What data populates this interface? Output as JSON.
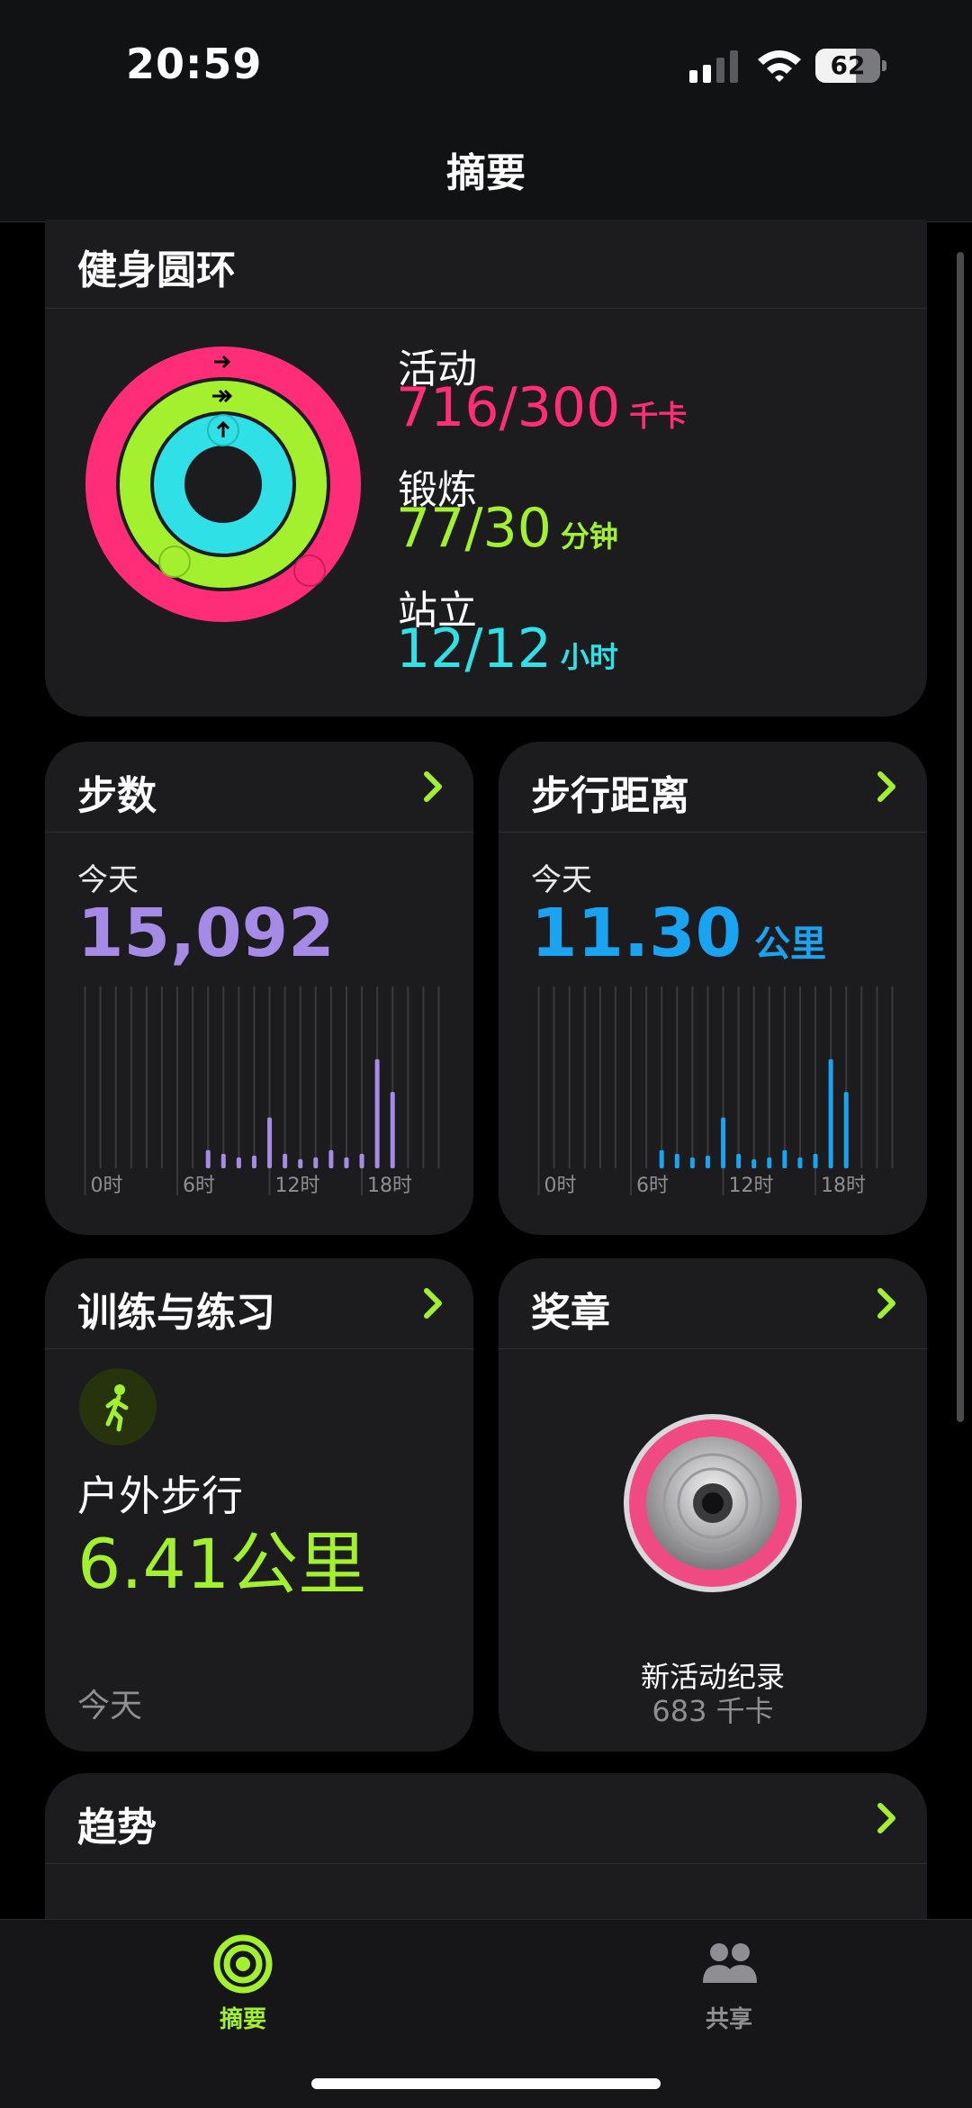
{
  "status_bar": {
    "time": "20:59",
    "battery": "62",
    "battery_level": 0.62
  },
  "nav": {
    "title": "摘要"
  },
  "rings": {
    "title": "健身圆环",
    "move": {
      "label": "活动",
      "value": "716/300",
      "unit": "千卡",
      "color": "#ff2d78"
    },
    "exercise": {
      "label": "锻炼",
      "value": "77/30",
      "unit": "分钟",
      "color": "#a3f02f"
    },
    "stand": {
      "label": "站立",
      "value": "12/12",
      "unit": "小时",
      "color": "#2fe0e6"
    }
  },
  "steps": {
    "title": "步数",
    "period": "今天",
    "value": "15,092",
    "color": "#a58ae6",
    "axis_labels": [
      "0时",
      "6时",
      "12时",
      "18时"
    ],
    "chart_data": {
      "type": "bar",
      "x": [
        8,
        9,
        10,
        11,
        12,
        13,
        14,
        15,
        16,
        17,
        18,
        19,
        20
      ],
      "values": [
        0.1,
        0.08,
        0.06,
        0.07,
        0.28,
        0.08,
        0.05,
        0.06,
        0.1,
        0.06,
        0.08,
        0.6,
        0.42
      ]
    }
  },
  "distance": {
    "title": "步行距离",
    "period": "今天",
    "value": "11.30",
    "unit": "公里",
    "color": "#1aa3f0",
    "axis_labels": [
      "0时",
      "6时",
      "12时",
      "18时"
    ],
    "chart_data": {
      "type": "bar",
      "x": [
        8,
        9,
        10,
        11,
        12,
        13,
        14,
        15,
        16,
        17,
        18,
        19,
        20
      ],
      "values": [
        0.1,
        0.08,
        0.06,
        0.07,
        0.28,
        0.08,
        0.05,
        0.06,
        0.1,
        0.06,
        0.08,
        0.6,
        0.42
      ]
    }
  },
  "workouts": {
    "title": "训练与练习",
    "icon": "outdoor-walk-icon",
    "name": "户外步行",
    "value": "6.41公里",
    "when": "今天"
  },
  "awards": {
    "title": "奖章",
    "icon": "medal-icon",
    "badge_title": "新活动纪录",
    "badge_sub": "683 千卡"
  },
  "trends": {
    "title": "趋势"
  },
  "tabs": [
    {
      "label": "摘要",
      "icon": "summary-rings-icon",
      "active": true
    },
    {
      "label": "共享",
      "icon": "sharing-people-icon",
      "active": false
    }
  ],
  "colors": {
    "accent": "#a3f02f",
    "card": "#1c1c1e",
    "inactive": "#8e8e93"
  }
}
